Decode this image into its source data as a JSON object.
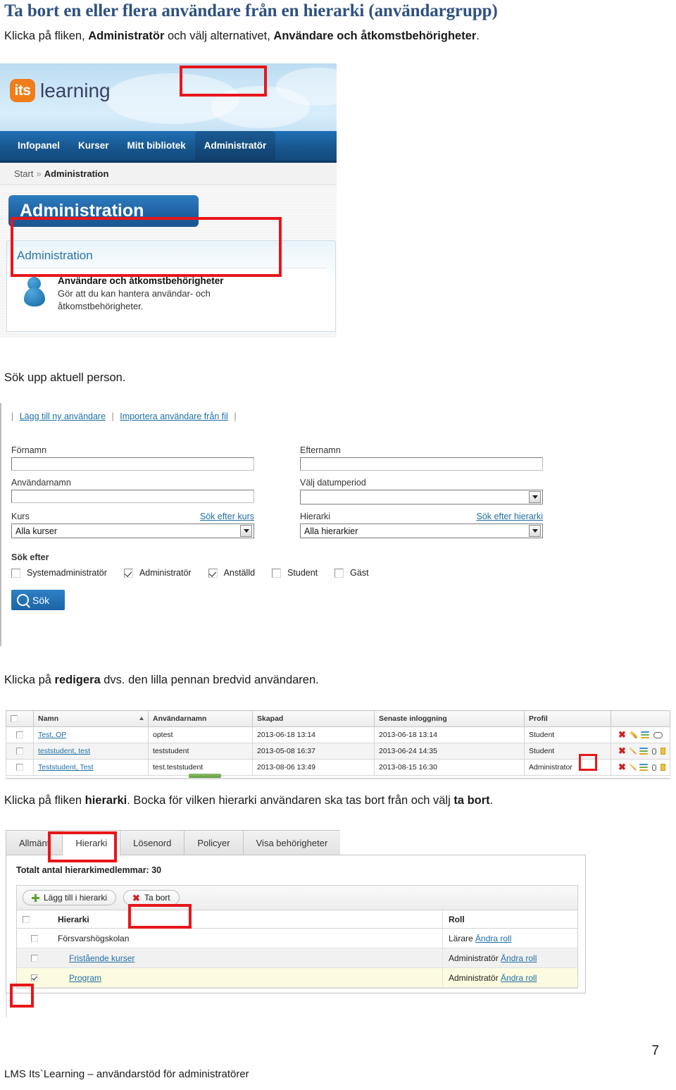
{
  "document": {
    "title": "Ta bort en eller flera användare från en hierarki (användargrupp)",
    "intro_prefix": "Klicka på fliken, ",
    "intro_bold1": "Administratör",
    "intro_mid": " och välj alternativet, ",
    "intro_bold2": "Användare och åtkomstbehörigheter",
    "intro_suffix": ".",
    "step2": "Sök upp aktuell person.",
    "step3_prefix": "Klicka på ",
    "step3_bold": "redigera",
    "step3_suffix": " dvs. den lilla pennan bredvid användaren.",
    "step4_prefix": "Klicka på fliken ",
    "step4_bold1": "hierarki",
    "step4_mid": ". Bocka för vilken hierarki användaren ska tas bort från och välj ",
    "step4_bold2": "ta bort",
    "step4_suffix": ".",
    "footer": "LMS Its`Learning – användarstöd för administratörer",
    "page_number": "7",
    "title_color": "#2e5180",
    "highlight_color": "#e8161b"
  },
  "screenshot1": {
    "logo": {
      "badge": "its",
      "word": "learning"
    },
    "nav_tabs": [
      {
        "label": "Infopanel",
        "active": false
      },
      {
        "label": "Kurser",
        "active": false
      },
      {
        "label": "Mitt bibliotek",
        "active": false
      },
      {
        "label": "Administratör",
        "active": true
      }
    ],
    "breadcrumb": {
      "root": "Start",
      "separator": "»",
      "current": "Administration"
    },
    "banner_title": "Administration",
    "panel_title": "Administration",
    "card": {
      "title": "Användare och åtkomstbehörigheter",
      "description_line1": "Gör att du kan hantera användar- och",
      "description_line2": "åtkomstbehörigheter."
    }
  },
  "screenshot2": {
    "toolbar_links": [
      "Lägg till ny användare",
      "Importera användare från fil"
    ],
    "fields": {
      "fornamn_label": "Förnamn",
      "fornamn_value": "",
      "efternamn_label": "Efternamn",
      "efternamn_value": "",
      "anvandarnamn_label": "Användarnamn",
      "anvandarnamn_value": "",
      "datumperiod_label": "Välj datumperiod",
      "datumperiod_value": "",
      "kurs_label": "Kurs",
      "kurs_link": "Sök efter kurs",
      "kurs_value": "Alla kurser",
      "hierarki_label": "Hierarki",
      "hierarki_link": "Sök efter hierarki",
      "hierarki_value": "Alla hierarkier"
    },
    "sok_efter_label": "Sök efter",
    "checkboxes": [
      {
        "label": "Systemadministratör",
        "checked": false
      },
      {
        "label": "Administratör",
        "checked": true
      },
      {
        "label": "Anställd",
        "checked": true
      },
      {
        "label": "Student",
        "checked": false
      },
      {
        "label": "Gäst",
        "checked": false
      }
    ],
    "search_button": "Sök"
  },
  "screenshot3": {
    "columns": [
      "Namn",
      "Användarnamn",
      "Skapad",
      "Senaste inloggning",
      "Profil"
    ],
    "rows": [
      {
        "namn": "Test, OP",
        "anvandarnamn": "optest",
        "skapad": "2013-06-18 13:14",
        "senaste": "2013-06-18 13:14",
        "profil": "Student",
        "has_mail": false
      },
      {
        "namn": "teststudent, test",
        "anvandarnamn": "teststudent",
        "skapad": "2013-05-08 16:37",
        "senaste": "2013-06-24 14:35",
        "profil": "Student",
        "has_mail": true
      },
      {
        "namn": "Teststudent, Test",
        "anvandarnamn": "test.teststudent",
        "skapad": "2013-08-06 13:49",
        "senaste": "2013-08-15 16:30",
        "profil": "Administrator",
        "has_mail": true
      }
    ]
  },
  "screenshot4": {
    "tabs": [
      {
        "label": "Allmänt",
        "active": false
      },
      {
        "label": "Hierarki",
        "active": true
      },
      {
        "label": "Lösenord",
        "active": false
      },
      {
        "label": "Policyer",
        "active": false
      },
      {
        "label": "Visa behörigheter",
        "active": false
      }
    ],
    "total_label": "Totalt antal hierarkimedlemmar: 30",
    "buttons": {
      "add": "Lägg till i hierarki",
      "remove": "Ta bort"
    },
    "columns": [
      "Hierarki",
      "Roll"
    ],
    "rows": [
      {
        "hierarki": "Försvarshögskolan",
        "roll": "Lärare",
        "roll_link": "Ändra roll",
        "checked": false,
        "indent": false,
        "is_link": false,
        "style": "plain"
      },
      {
        "hierarki": "Fristående kurser",
        "roll": "Administratör",
        "roll_link": "Ändra roll",
        "checked": false,
        "indent": true,
        "is_link": true,
        "style": "shade"
      },
      {
        "hierarki": "Program",
        "roll": "Administratör",
        "roll_link": "Ändra roll",
        "checked": true,
        "indent": true,
        "is_link": true,
        "style": "sel"
      }
    ]
  }
}
